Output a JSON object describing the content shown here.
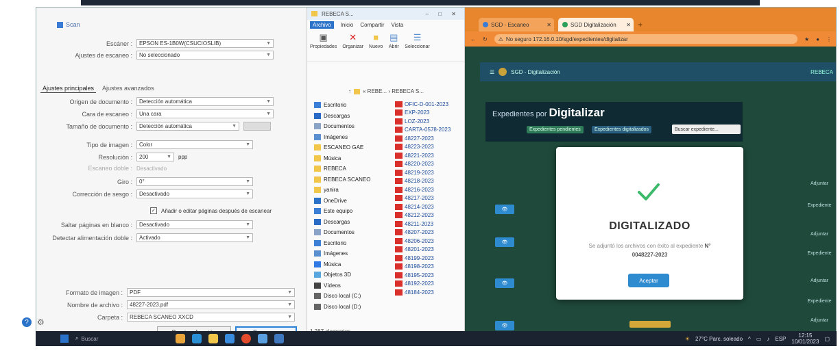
{
  "scan_dialog": {
    "title": "Scan",
    "rows": [
      {
        "label": "Escáner :",
        "value": "EPSON ES-1B0W(CSUCIOSLIB)"
      },
      {
        "label": "Ajustes de escaneo :",
        "value": "No seleccionado"
      }
    ],
    "tabs": [
      "Ajustes principales",
      "Ajustes avanzados"
    ],
    "settings": [
      {
        "label": "Origen de documento :",
        "value": "Detección automática"
      },
      {
        "label": "Cara de escaneo :",
        "value": "Una cara"
      },
      {
        "label": "Tamaño de documento :",
        "value": "Detección automática"
      },
      {
        "label": "Tipo de imagen :",
        "value": "Color"
      },
      {
        "label": "Resolución :",
        "value": "200",
        "unit": "ppp"
      },
      {
        "label": "Escaneo doble :",
        "value": "Desactivado"
      },
      {
        "label": "Giro :",
        "value": "0°"
      },
      {
        "label": "Corrección de sesgo :",
        "value": "Desactivado"
      }
    ],
    "checkbox_label": "Añadir o editar páginas después de escanear",
    "more_settings": [
      {
        "label": "Saltar páginas en blanco :",
        "value": "Desactivado"
      },
      {
        "label": "Detectar alimentación doble :",
        "value": "Activado"
      }
    ],
    "output": [
      {
        "label": "Formato de imagen :",
        "value": "PDF"
      },
      {
        "label": "Nombre de archivo :",
        "value": "48227-2023.pdf"
      },
      {
        "label": "Carpeta :",
        "value": "REBECA SCANEO XXCD"
      }
    ],
    "preview_button": "Previsualización",
    "scan_button": "Escanear"
  },
  "explorer": {
    "title": "REBECA S...",
    "menu": [
      "Archivo",
      "Inicio",
      "Compartir",
      "Vista"
    ],
    "ribbon": [
      {
        "label": "Propiedades",
        "icon": "properties-icon"
      },
      {
        "label": "Organizar",
        "icon": "delete-icon"
      },
      {
        "label": "Nuevo",
        "icon": "folder-icon"
      },
      {
        "label": "Abrir",
        "icon": "open-icon"
      },
      {
        "label": "Seleccionar",
        "icon": "select-icon"
      }
    ],
    "breadcrumb": "« REBE... › REBECA S...",
    "nav": [
      {
        "label": "Escritorio",
        "color": "#3b7fd6"
      },
      {
        "label": "Descargas",
        "color": "#2a6bc6"
      },
      {
        "label": "Documentos",
        "color": "#8aa4c8"
      },
      {
        "label": "Imágenes",
        "color": "#5a8fd0"
      },
      {
        "label": "ESCANEO GAE",
        "color": "#f2c64a"
      },
      {
        "label": "Música",
        "color": "#f2c64a"
      },
      {
        "label": "REBECA",
        "color": "#f2c64a"
      },
      {
        "label": "REBECA SCANEO",
        "color": "#f2c64a"
      },
      {
        "label": "yanira",
        "color": "#f2c64a"
      },
      {
        "label": "OneDrive",
        "color": "#2b72c9"
      },
      {
        "label": "Este equipo",
        "color": "#3b7fd6"
      },
      {
        "label": "Descargas",
        "color": "#2a6bc6"
      },
      {
        "label": "Documentos",
        "color": "#8aa4c8"
      },
      {
        "label": "Escritorio",
        "color": "#3b7fd6"
      },
      {
        "label": "Imágenes",
        "color": "#5a8fd0"
      },
      {
        "label": "Música",
        "color": "#2f7ae5"
      },
      {
        "label": "Objetos 3D",
        "color": "#5aa7e0"
      },
      {
        "label": "Vídeos",
        "color": "#444"
      },
      {
        "label": "Disco local (C:)",
        "color": "#666"
      },
      {
        "label": "Disco local (D:)",
        "color": "#666"
      }
    ],
    "files": [
      "OFIC-D-001-2023",
      "EXP-2023",
      "LOZ-2023",
      "CARTA-0578-2023",
      "48227-2023",
      "48223-2023",
      "48221-2023",
      "48220-2023",
      "48219-2023",
      "48218-2023",
      "48216-2023",
      "48217-2023",
      "48214-2023",
      "48212-2023",
      "48211-2023",
      "48207-2023",
      "48206-2023",
      "48201-2023",
      "48199-2023",
      "48198-2023",
      "48195-2023",
      "48192-2023",
      "48184-2023"
    ],
    "status": "1.287 elementos"
  },
  "browser": {
    "tabs": [
      {
        "label": "SGD - Escaneo",
        "active": false
      },
      {
        "label": "SGD Digitalización",
        "active": true
      }
    ],
    "address": "No seguro  172.16.0.10/sgd/expedientes/digitalizar",
    "app_name": "SGD - Digitalización",
    "user_label": "REBECA",
    "banner_small": "Expedientes por",
    "banner_big": "Digitalizar",
    "chips": [
      "Expedientes pendientes",
      "Expedientes digitalizados"
    ],
    "search_placeholder": "Buscar expediente...",
    "modal": {
      "title": "DIGITALIZADO",
      "message": "Se adjuntó los archivos con éxito al expediente",
      "code": "N° 0048227-2023",
      "ok_button": "Aceptar"
    },
    "right_col": [
      "Adjuntar",
      "Expediente",
      "Adjuntar",
      "Expediente",
      "Adjuntar",
      "Expediente",
      "Adjuntar"
    ]
  },
  "taskbar": {
    "search": "Buscar",
    "weather": "27°C Parc. soleado",
    "lang": "ESP",
    "time": "12:15",
    "date": "10/01/2023"
  }
}
